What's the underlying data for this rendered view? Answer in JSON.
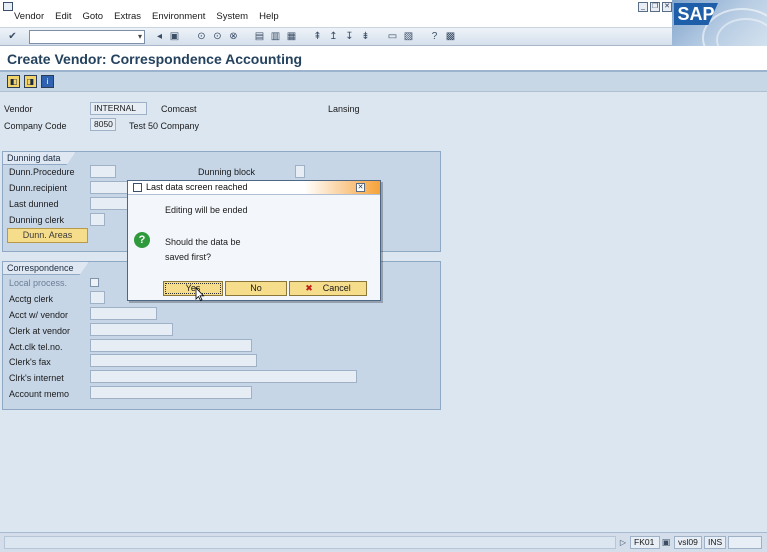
{
  "menubar": {
    "items": [
      "Vendor",
      "Edit",
      "Goto",
      "Extras",
      "Environment",
      "System",
      "Help"
    ]
  },
  "sap_logo": "SAP",
  "toolbar": {
    "command_field_value": ""
  },
  "header": {
    "title": "Create Vendor: Correspondence Accounting"
  },
  "vendor_info": {
    "vendor_label": "Vendor",
    "vendor_value": "INTERNAL",
    "vendor_name": "Comcast",
    "vendor_city": "Lansing",
    "company_code_label": "Company Code",
    "company_code_value": "8050",
    "company_name": "Test 50 Company"
  },
  "dunning": {
    "title": "Dunning data",
    "procedure_label": "Dunn.Procedure",
    "block_label": "Dunning block",
    "recipient_label": "Dunn.recipient",
    "last_dunned_label": "Last dunned",
    "clerk_label": "Dunning clerk",
    "areas_button": "Dunn. Areas"
  },
  "correspondence": {
    "title": "Correspondence",
    "local_process_label": "Local process.",
    "acctg_clerk_label": "Acctg clerk",
    "acct_vendor_label": "Acct w/ vendor",
    "clerk_vendor_label": "Clerk at vendor",
    "clerk_tel_label": "Act.clk tel.no.",
    "clerk_fax_label": "Clerk's fax",
    "clerk_internet_label": "Clrk's internet",
    "account_memo_label": "Account memo"
  },
  "dialog": {
    "title": "Last data screen reached",
    "message1": "Editing will be ended",
    "message2": "Should the data be",
    "message3": "saved first?",
    "yes_label": "Yes",
    "no_label": "No",
    "cancel_label": "Cancel"
  },
  "status": {
    "transaction": "FK01",
    "server": "vsl09",
    "mode": "INS"
  }
}
